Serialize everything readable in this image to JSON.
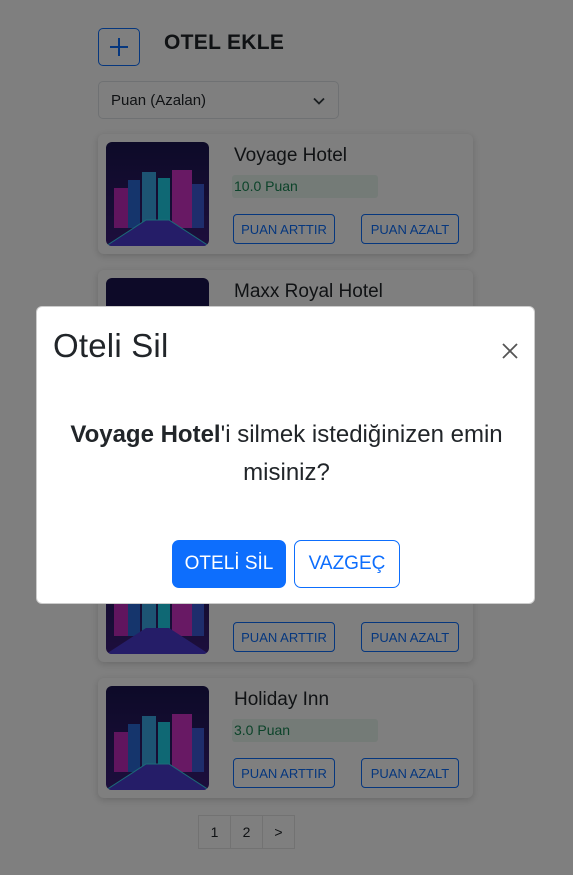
{
  "header": {
    "add_icon": "plus-icon",
    "title": "OTEL EKLE"
  },
  "sort": {
    "selected": "Puan (Azalan)",
    "icon": "chevron-down-icon"
  },
  "hotels": [
    {
      "name": "Voyage Hotel",
      "score": "10.0 Puan",
      "increase": "PUAN ARTTIR",
      "decrease": "PUAN AZALT"
    },
    {
      "name": "Maxx Royal Hotel",
      "score": "",
      "increase": "",
      "decrease": ""
    },
    {
      "name": "",
      "score": "",
      "increase": "PUAN ARTTIR",
      "decrease": "PUAN AZALT"
    },
    {
      "name": "Holiday Inn",
      "score": "3.0 Puan",
      "increase": "PUAN ARTTIR",
      "decrease": "PUAN AZALT"
    }
  ],
  "pagination": {
    "pages": [
      "1",
      "2"
    ],
    "next": ">"
  },
  "modal": {
    "title": "Oteli Sil",
    "close_icon": "close-icon",
    "hotel_name": "Voyage Hotel",
    "message": "'i silmek istediğinizen emin misiniz?",
    "confirm_label": "OTELİ SİL",
    "cancel_label": "VAZGEÇ"
  },
  "colors": {
    "primary": "#0d6efd",
    "score_text": "#198754",
    "score_bg": "#e9f7ef"
  }
}
